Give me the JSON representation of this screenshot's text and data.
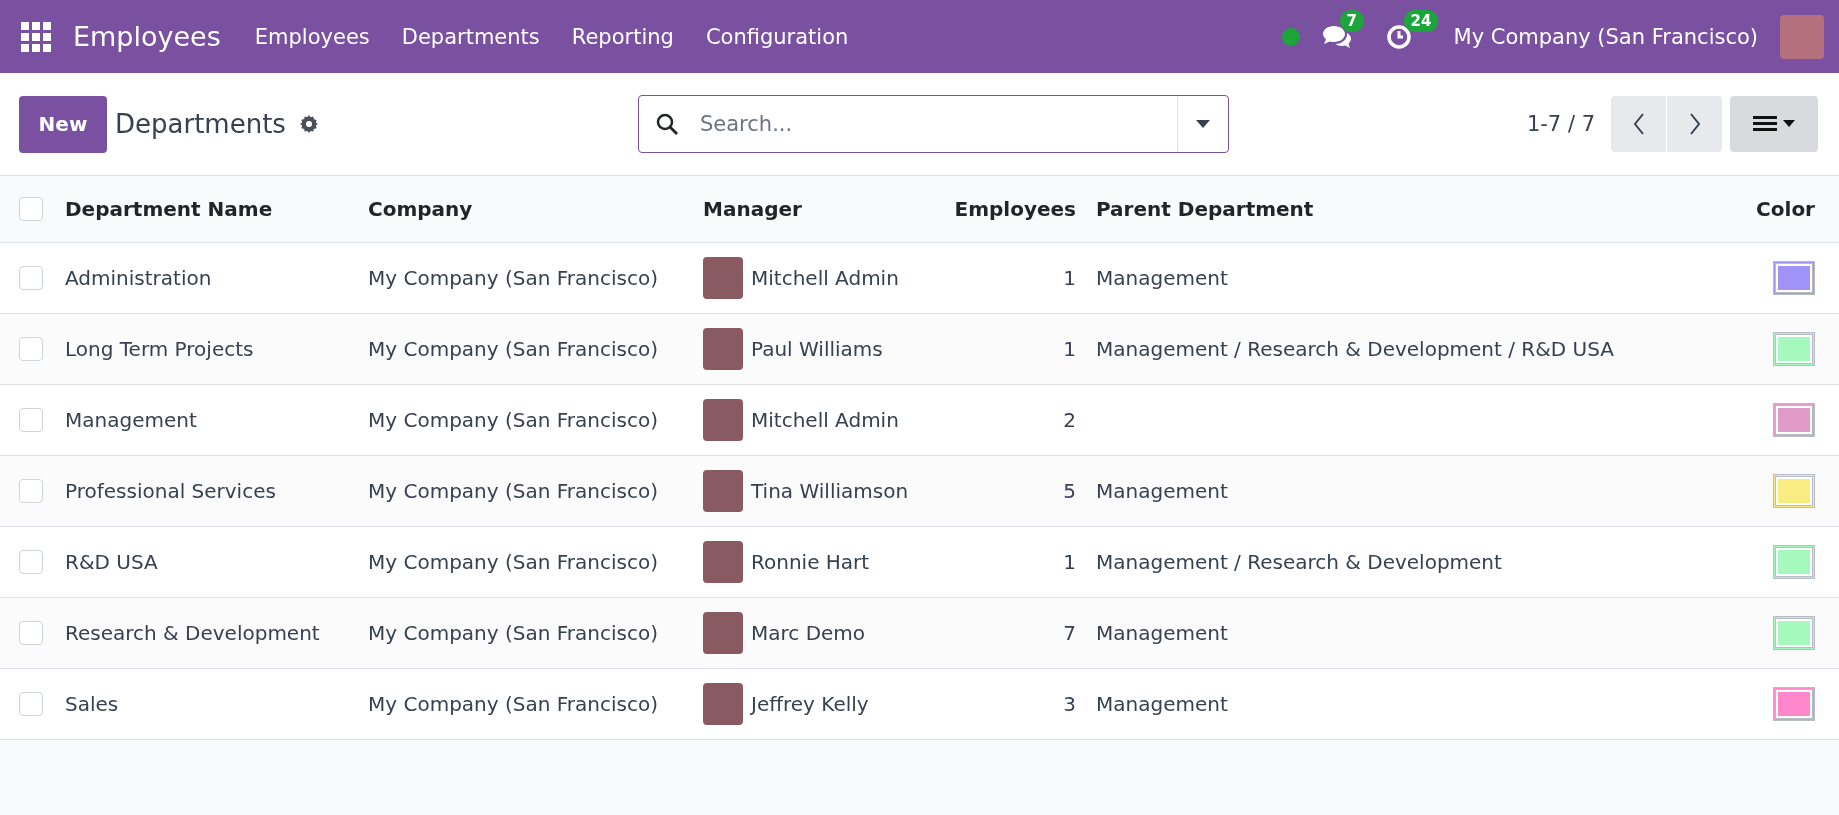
{
  "navbar": {
    "app_name": "Employees",
    "menu": [
      "Employees",
      "Departments",
      "Reporting",
      "Configuration"
    ],
    "messages_badge": "7",
    "activities_badge": "24",
    "company": "My Company (San Francisco)"
  },
  "control_panel": {
    "new_button": "New",
    "title": "Departments",
    "search": {
      "placeholder": "Search..."
    },
    "pager": "1-7 / 7"
  },
  "table": {
    "columns": [
      "Department Name",
      "Company",
      "Manager",
      "Employees",
      "Parent Department",
      "Color"
    ],
    "header_checked": false,
    "rows": [
      {
        "checked": false,
        "name": "Administration",
        "company": "My Company (San Francisco)",
        "manager": "Mitchell Admin",
        "employees": "1",
        "parent": "Management",
        "color": "#a293f8"
      },
      {
        "checked": false,
        "name": "Long Term Projects",
        "company": "My Company (San Francisco)",
        "manager": "Paul Williams",
        "employees": "1",
        "parent": "Management / Research & Development / R&D USA",
        "color": "#a6f9bd"
      },
      {
        "checked": false,
        "name": "Management",
        "company": "My Company (San Francisco)",
        "manager": "Mitchell Admin",
        "employees": "2",
        "parent": "",
        "color": "#e09bcb"
      },
      {
        "checked": false,
        "name": "Professional Services",
        "company": "My Company (San Francisco)",
        "manager": "Tina Williamson",
        "employees": "5",
        "parent": "Management",
        "color": "#f9ec80"
      },
      {
        "checked": false,
        "name": "R&D USA",
        "company": "My Company (San Francisco)",
        "manager": "Ronnie Hart",
        "employees": "1",
        "parent": "Management / Research & Development",
        "color": "#a6f9bd"
      },
      {
        "checked": false,
        "name": "Research & Development",
        "company": "My Company (San Francisco)",
        "manager": "Marc Demo",
        "employees": "7",
        "parent": "Management",
        "color": "#a6f9bd"
      },
      {
        "checked": false,
        "name": "Sales",
        "company": "My Company (San Francisco)",
        "manager": "Jeffrey Kelly",
        "employees": "3",
        "parent": "Management",
        "color": "#ff88cc"
      }
    ]
  }
}
